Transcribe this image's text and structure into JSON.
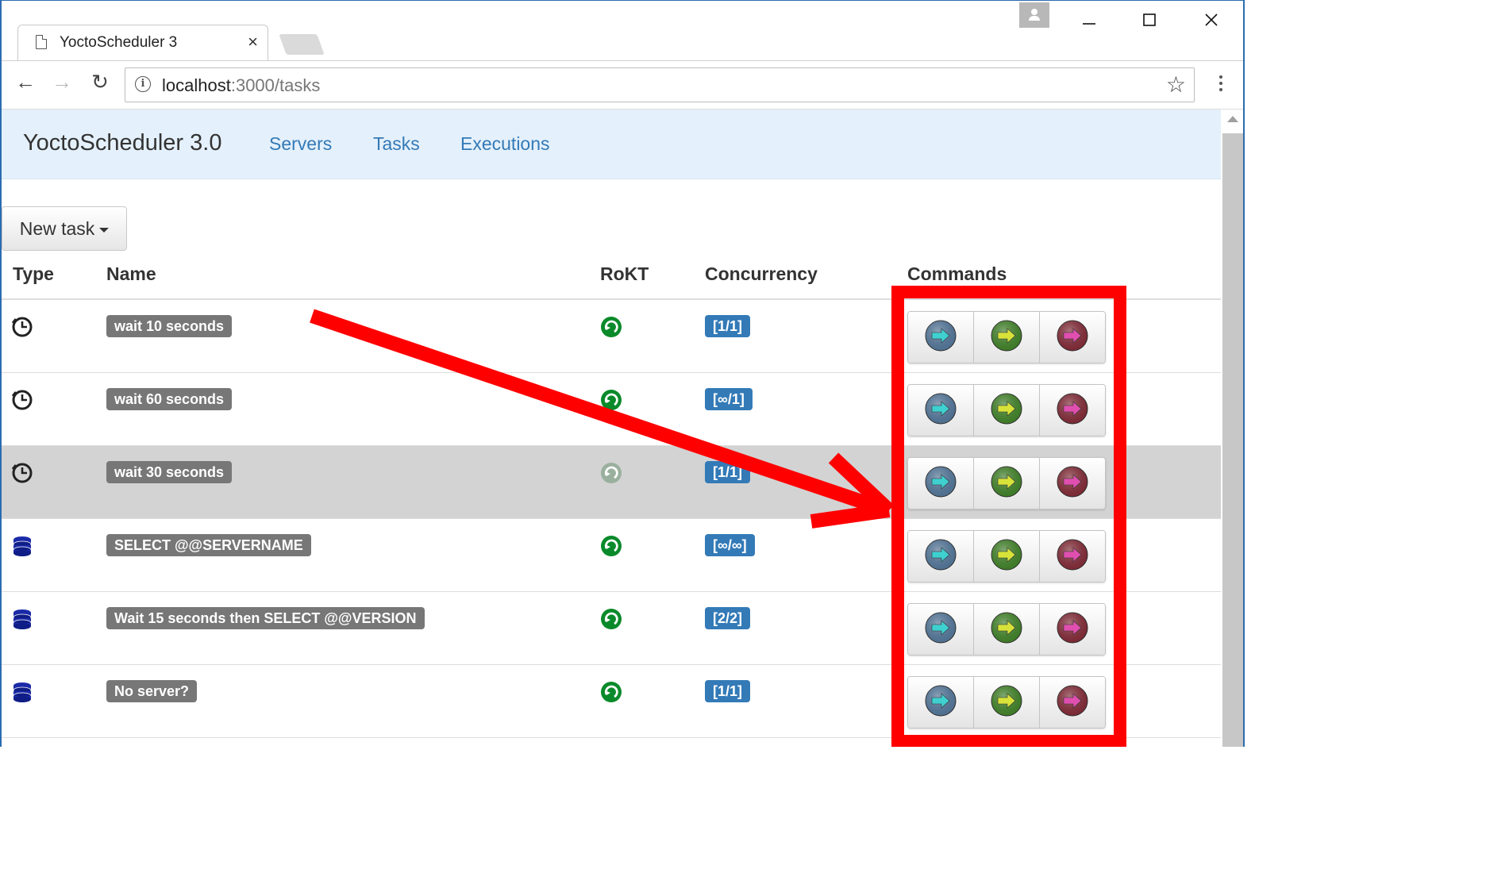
{
  "browser": {
    "tab_title": "YoctoScheduler 3",
    "close_glyph": "×",
    "url_host": "localhost",
    "url_path": ":3000/tasks",
    "back_glyph": "←",
    "forward_glyph": "→",
    "reload_glyph": "↻",
    "star_glyph": "☆",
    "minimize_glyph": "—",
    "maximize_glyph": "☐",
    "winclose_glyph": "✕"
  },
  "navbar": {
    "brand": "YoctoScheduler 3.0",
    "links": [
      "Servers",
      "Tasks",
      "Executions"
    ]
  },
  "new_task_button": "New task",
  "table": {
    "headers": [
      "Type",
      "Name",
      "RoKT",
      "Concurrency",
      "Commands"
    ],
    "rows": [
      {
        "type_icon": "clock-icon",
        "name": "wait 10 seconds",
        "rokt": "active",
        "concurrency": "[1/1]"
      },
      {
        "type_icon": "clock-icon",
        "name": "wait 60 seconds",
        "rokt": "active",
        "concurrency": "[∞/1]"
      },
      {
        "type_icon": "clock-icon",
        "name": "wait 30 seconds",
        "rokt": "inactive",
        "concurrency": "[1/1]",
        "highlighted": true
      },
      {
        "type_icon": "database-icon",
        "name": "SELECT @@SERVERNAME",
        "rokt": "active",
        "concurrency": "[∞/∞]"
      },
      {
        "type_icon": "database-icon",
        "name": "Wait 15 seconds then SELECT @@VERSION",
        "rokt": "active",
        "concurrency": "[2/2]"
      },
      {
        "type_icon": "database-icon",
        "name": "No server?",
        "rokt": "active",
        "concurrency": "[1/1]"
      }
    ],
    "commands": [
      {
        "icon": "blue-arrow-icon",
        "color": "#4f6f8f",
        "arrow": "#3fd0d0"
      },
      {
        "icon": "green-arrow-icon",
        "color": "#3e7a28",
        "arrow": "#d8e33a"
      },
      {
        "icon": "red-arrow-icon",
        "color": "#7a2a35",
        "arrow": "#e04fb0"
      }
    ]
  },
  "colors": {
    "annotation_red": "#ff0000",
    "label_gray": "#777777",
    "label_blue": "#337ab7",
    "link_blue": "#337ab7",
    "navbar_bg": "#e4f0fb",
    "rokt_green": "#0a8a2a"
  }
}
